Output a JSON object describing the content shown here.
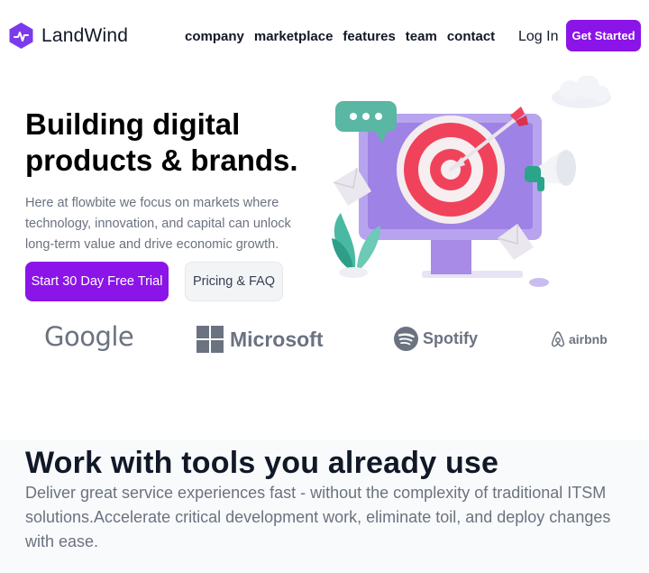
{
  "nav": {
    "brand": "LandWind",
    "links": [
      "company",
      "marketplace",
      "features",
      "team",
      "contact"
    ],
    "login": "Log In",
    "cta": "Get Started"
  },
  "hero": {
    "title": "Building digital products & brands.",
    "description": "Here at flowbite we focus on markets where technology, innovation, and capital can unlock long-term value and drive economic growth.",
    "primary_button": "Start 30 Day Free Trial",
    "secondary_button": "Pricing & FAQ"
  },
  "brands": {
    "google": "Google",
    "microsoft": "Microsoft",
    "spotify": "Spotify",
    "airbnb": "airbnb"
  },
  "tools": {
    "title": "Work with tools you already use",
    "description": "Deliver great service experiences fast - without the complexity of traditional ITSM solutions.Accelerate critical development work, eliminate toil, and deploy changes with ease."
  },
  "colors": {
    "accent": "#8b14e8",
    "text": "#111827",
    "muted": "#6b7280"
  }
}
